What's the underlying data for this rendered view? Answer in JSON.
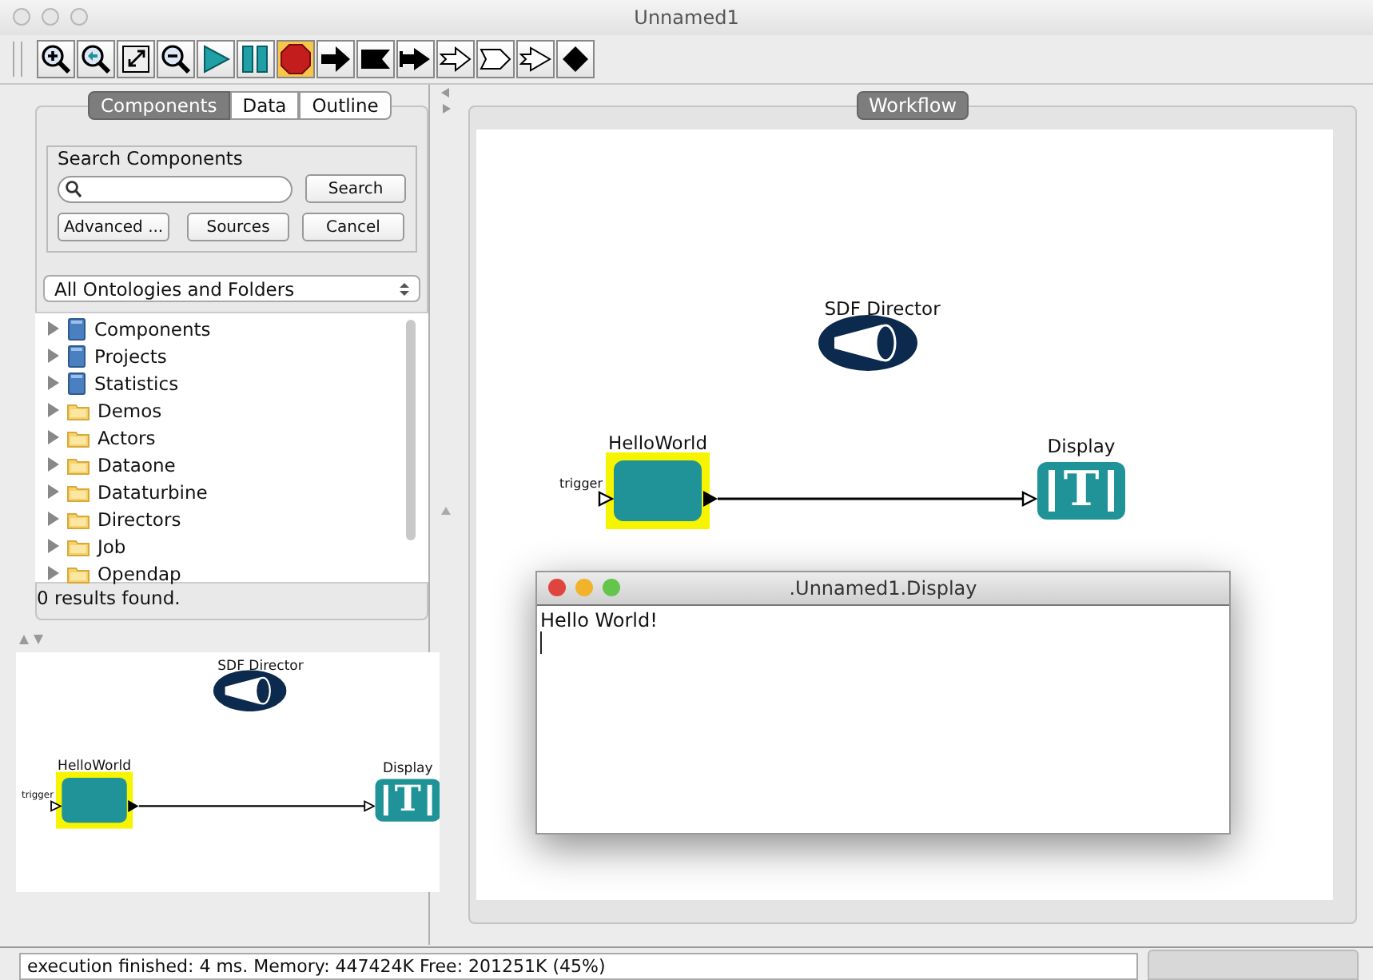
{
  "window": {
    "title": "Unnamed1"
  },
  "toolbar": [
    {
      "kind": "zoom-in",
      "selected": false
    },
    {
      "kind": "zoom-reset",
      "selected": false
    },
    {
      "kind": "zoom-fit",
      "selected": false
    },
    {
      "kind": "zoom-out",
      "selected": false
    },
    {
      "kind": "run",
      "selected": false
    },
    {
      "kind": "pause",
      "selected": false
    },
    {
      "kind": "stop",
      "selected": true
    },
    {
      "kind": "arrow",
      "selected": false
    },
    {
      "kind": "flag",
      "selected": false
    },
    {
      "kind": "short-arrow",
      "selected": false
    },
    {
      "kind": "hollow-arrow",
      "selected": false
    },
    {
      "kind": "hollow-flag",
      "selected": false
    },
    {
      "kind": "hollow-short-arrow",
      "selected": false
    },
    {
      "kind": "diamond",
      "selected": false
    }
  ],
  "library": {
    "tabs": [
      {
        "label": "Components",
        "selected": true
      },
      {
        "label": "Data",
        "selected": false
      },
      {
        "label": "Outline",
        "selected": false
      }
    ],
    "search": {
      "title": "Search Components",
      "buttons": [
        "Search",
        "Advanced ...",
        "Sources",
        "Cancel"
      ]
    },
    "scope": "All Ontologies and Folders",
    "tree": [
      {
        "label": "Components",
        "kind": "ontology",
        "expanded": false
      },
      {
        "label": "Projects",
        "kind": "ontology",
        "expanded": false
      },
      {
        "label": "Statistics",
        "kind": "ontology",
        "expanded": false
      },
      {
        "label": "Demos",
        "kind": "folder",
        "expanded": false
      },
      {
        "label": "Actors",
        "kind": "folder",
        "expanded": false
      },
      {
        "label": "Dataone",
        "kind": "folder",
        "expanded": false
      },
      {
        "label": "Dataturbine",
        "kind": "folder",
        "expanded": false
      },
      {
        "label": "Directors",
        "kind": "folder",
        "expanded": false
      },
      {
        "label": "Job",
        "kind": "folder",
        "expanded": false
      },
      {
        "label": "Opendap",
        "kind": "folder",
        "expanded": false
      }
    ],
    "results": "0 results found."
  },
  "overview": {
    "director": "SDF Director",
    "source": {
      "label": "HelloWorld",
      "port": "trigger",
      "selected": true
    },
    "sink": {
      "label": "Display",
      "icon_text": "T"
    }
  },
  "workflow": {
    "tab": {
      "label": "Workflow",
      "selected": true
    },
    "director": "SDF Director",
    "source": {
      "label": "HelloWorld",
      "port": "trigger",
      "selected": true
    },
    "sink": {
      "label": "Display",
      "icon_text": "T"
    }
  },
  "display_window": {
    "title": ".Unnamed1.Display",
    "text": "Hello World!"
  },
  "status_bar": {
    "text": "execution finished: 4 ms. Memory: 447424K Free: 201251K (45%)"
  }
}
